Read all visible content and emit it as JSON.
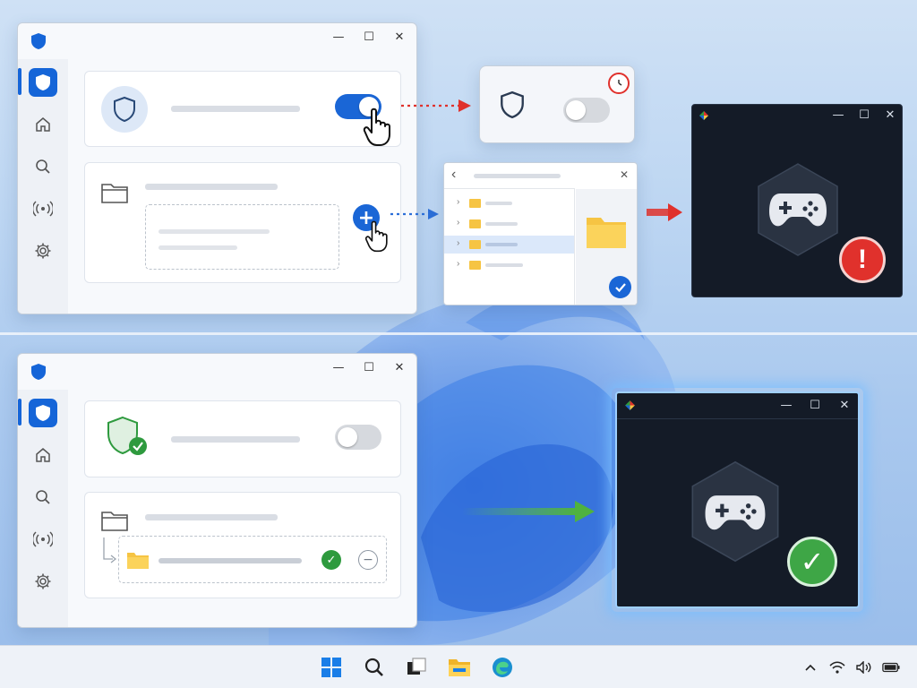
{
  "window_controls": {
    "minimize": "—",
    "maximize": "☐",
    "close": "✕"
  },
  "colors": {
    "accent": "#1565d8",
    "warning_red": "#e0312c",
    "success_green": "#2e9a3e",
    "dark_window_bg": "#141b27",
    "folder_yellow": "#f6c443"
  },
  "top_scenario": {
    "security_window": {
      "sidebar": [
        "shield-icon",
        "home-icon",
        "search-icon",
        "broadcast-icon",
        "gear-icon"
      ],
      "realtime_protection": {
        "state": "on",
        "icon": "shield-icon"
      },
      "folder_card": {
        "add_button_symbol": "+",
        "icon": "folder-icon"
      }
    },
    "popup_toggle": {
      "state": "off",
      "badge": "clock-icon"
    },
    "folder_picker": {
      "back_symbol": "‹",
      "close_symbol": "✕",
      "rows": 4,
      "badge": "check-icon"
    },
    "game_window": {
      "status": "error",
      "alert_symbol": "!"
    }
  },
  "bottom_scenario": {
    "security_window": {
      "sidebar": [
        "shield-icon",
        "home-icon",
        "search-icon",
        "broadcast-icon",
        "gear-icon"
      ],
      "realtime_protection": {
        "state": "off",
        "icon": "shield-check-icon"
      },
      "excluded_folder": {
        "status_symbol": "✓",
        "remove_symbol": "−"
      }
    },
    "game_window": {
      "status": "ok",
      "check_symbol": "✓"
    }
  },
  "taskbar": {
    "apps": [
      "start-icon",
      "search-icon",
      "task-view-icon",
      "file-explorer-icon",
      "edge-icon"
    ],
    "tray": [
      "chevron-up-icon",
      "wifi-icon",
      "volume-icon",
      "battery-icon"
    ]
  }
}
